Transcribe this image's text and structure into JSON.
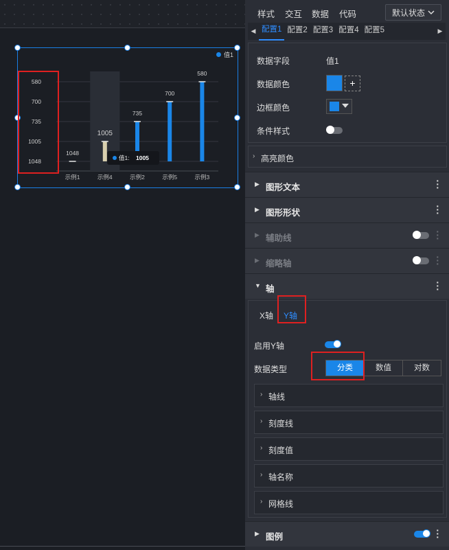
{
  "chart_data": {
    "type": "bar",
    "categories": [
      "示例1",
      "示例4",
      "示例2",
      "示例5",
      "示例3"
    ],
    "series": [
      {
        "name": "值1",
        "values": [
          1048,
          1005,
          735,
          700,
          580
        ]
      }
    ],
    "y_tick_labels": [
      "580",
      "700",
      "735",
      "1005",
      "1048"
    ],
    "y_axis_type": "category",
    "highlight_category": "示例4",
    "tooltip": {
      "series": "值1:",
      "value": "1005"
    },
    "legend_position": "top-right",
    "grid": true,
    "colors": {
      "bar": "#1a86e8",
      "highlight": "#d8cfae"
    }
  },
  "legend": {
    "label": "值1"
  },
  "panel": {
    "top_tabs": [
      "样式",
      "交互",
      "数据",
      "代码"
    ],
    "state_select": "默认状态",
    "config_tabs": [
      "配置1",
      "配置2",
      "配置3",
      "配置4",
      "配置5"
    ],
    "active_config": "配置1",
    "fields": {
      "data_field_label": "数据字段",
      "data_field_value": "值1",
      "data_color_label": "数据颜色",
      "border_color_label": "边框颜色",
      "condition_style_label": "条件样式",
      "add_label": "+"
    },
    "highlight_color": "高亮颜色",
    "sections": {
      "shape_text": "图形文本",
      "shape_style": "图形形状",
      "aux_line": "辅助线",
      "zoom_axis": "缩略轴",
      "axis": "轴",
      "legend": "图例"
    },
    "axis": {
      "x_tab": "X轴",
      "y_tab": "Y轴",
      "enable_y": "启用Y轴",
      "data_type_label": "数据类型",
      "data_type_options": [
        "分类",
        "数值",
        "对数"
      ],
      "data_type_selected": "分类",
      "sub_sections": [
        "轴线",
        "刻度线",
        "刻度值",
        "轴名称",
        "网格线"
      ]
    },
    "colors": {
      "accent": "#1a86e8",
      "highlight_box": "#e02020"
    }
  }
}
